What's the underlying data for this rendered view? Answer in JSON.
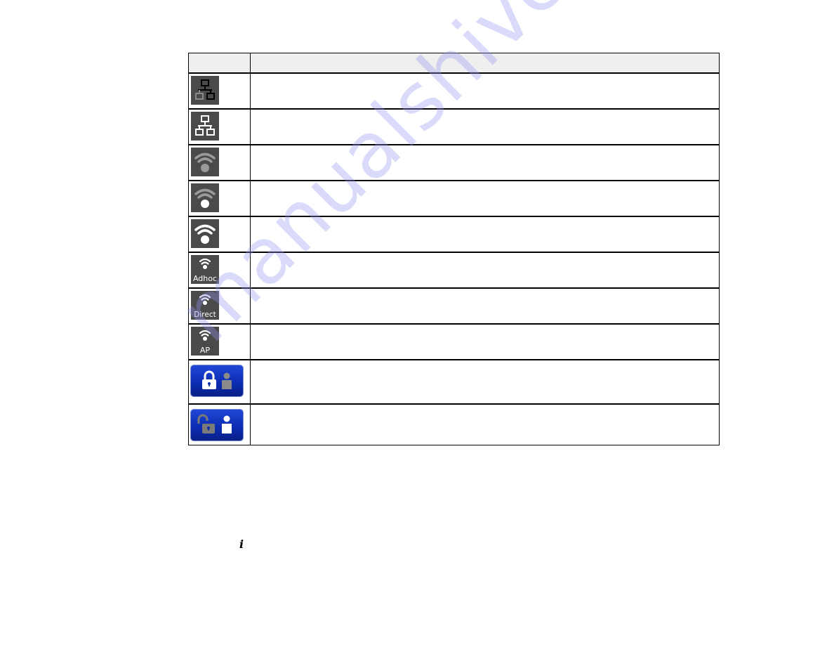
{
  "table": {
    "headers": {
      "icon": "",
      "description": ""
    },
    "rows": [
      {
        "icon": "wired-lan-disconnected-icon",
        "description": ""
      },
      {
        "icon": "wired-lan-connected-icon",
        "description": ""
      },
      {
        "icon": "wifi-no-signal-icon",
        "description": ""
      },
      {
        "icon": "wifi-weak-signal-icon",
        "description": ""
      },
      {
        "icon": "wifi-strong-signal-icon",
        "description": ""
      },
      {
        "icon": "wifi-adhoc-icon",
        "label": "Adhoc",
        "description": ""
      },
      {
        "icon": "wifi-direct-icon",
        "label": "Direct",
        "description": ""
      },
      {
        "icon": "wifi-ap-icon",
        "label": "AP",
        "description": ""
      },
      {
        "icon": "lock-locked-user-inactive-icon",
        "description": ""
      },
      {
        "icon": "lock-unlocked-user-active-icon",
        "description": ""
      }
    ]
  },
  "info_glyph": "i",
  "watermark": "manualshive.com",
  "colors": {
    "icon_bg": "#4a4a4a",
    "lock_bg": "#0b2bb0",
    "header_bg": "#efefef",
    "watermark": "#9696f0"
  }
}
